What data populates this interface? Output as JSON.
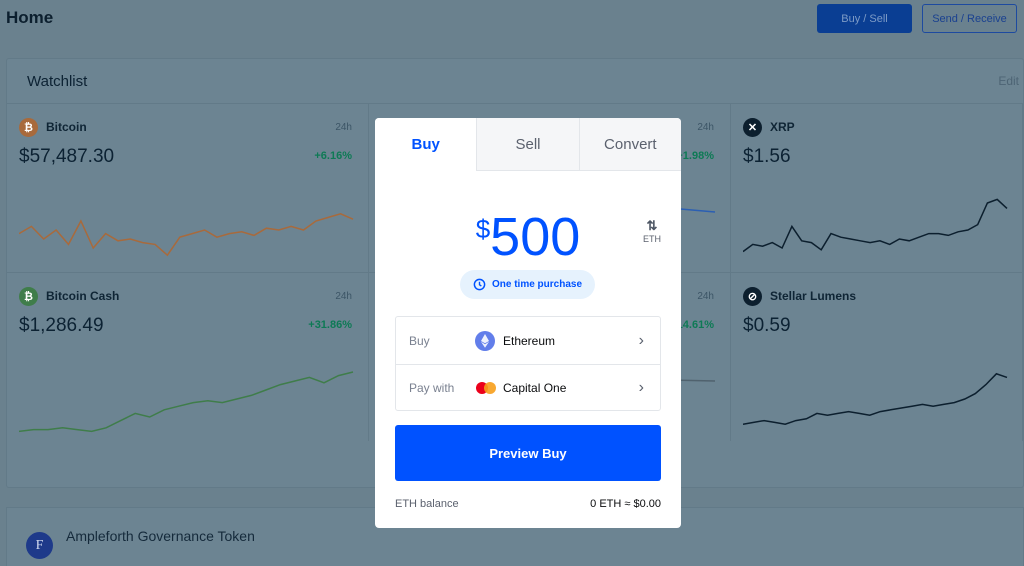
{
  "header": {
    "title": "Home",
    "buy_sell": "Buy / Sell",
    "send_receive": "Send / Receive"
  },
  "watchlist": {
    "title": "Watchlist",
    "edit": "Edit",
    "cards": [
      {
        "name": "Bitcoin",
        "period": "24h",
        "price": "$57,487.30",
        "change": "+6.16%",
        "color": "#a86a3c",
        "icon": "bitcoin-icon",
        "glyph": "₿"
      },
      {
        "name": "",
        "period": "24h",
        "price": "",
        "change": "+1.98%",
        "color": "#2b5fb3",
        "icon": "ethereum-icon",
        "glyph": ""
      },
      {
        "name": "XRP",
        "period": "",
        "price": "$1.56",
        "change": "",
        "color": "#0c1f2e",
        "icon": "xrp-icon",
        "glyph": "✕"
      },
      {
        "name": "Bitcoin Cash",
        "period": "24h",
        "price": "$1,286.49",
        "change": "+31.86%",
        "color": "#3f7d4a",
        "icon": "bitcoin-cash-icon",
        "glyph": "₿"
      },
      {
        "name": "",
        "period": "24h",
        "price": "",
        "change": "+14.61%",
        "color": "#50626e",
        "icon": "coin-icon",
        "glyph": ""
      },
      {
        "name": "Stellar Lumens",
        "period": "",
        "price": "$0.59",
        "change": "",
        "color": "#0c1f2e",
        "icon": "stellar-icon",
        "glyph": "⊘"
      }
    ]
  },
  "asset_row": {
    "name": "Ampleforth Governance Token"
  },
  "modal": {
    "tabs": [
      "Buy",
      "Sell",
      "Convert"
    ],
    "active_tab": "Buy",
    "currency_symbol": "$",
    "amount": "500",
    "switch_unit": "ETH",
    "frequency": "One time purchase",
    "buy_label": "Buy",
    "buy_asset": "Ethereum",
    "pay_label": "Pay with",
    "pay_method": "Capital One",
    "preview_button": "Preview Buy",
    "balance_label": "ETH balance",
    "balance_value": "0 ETH ≈ $0.00"
  },
  "colors": {
    "accent": "#0052ff",
    "positive": "#0e7a55"
  }
}
